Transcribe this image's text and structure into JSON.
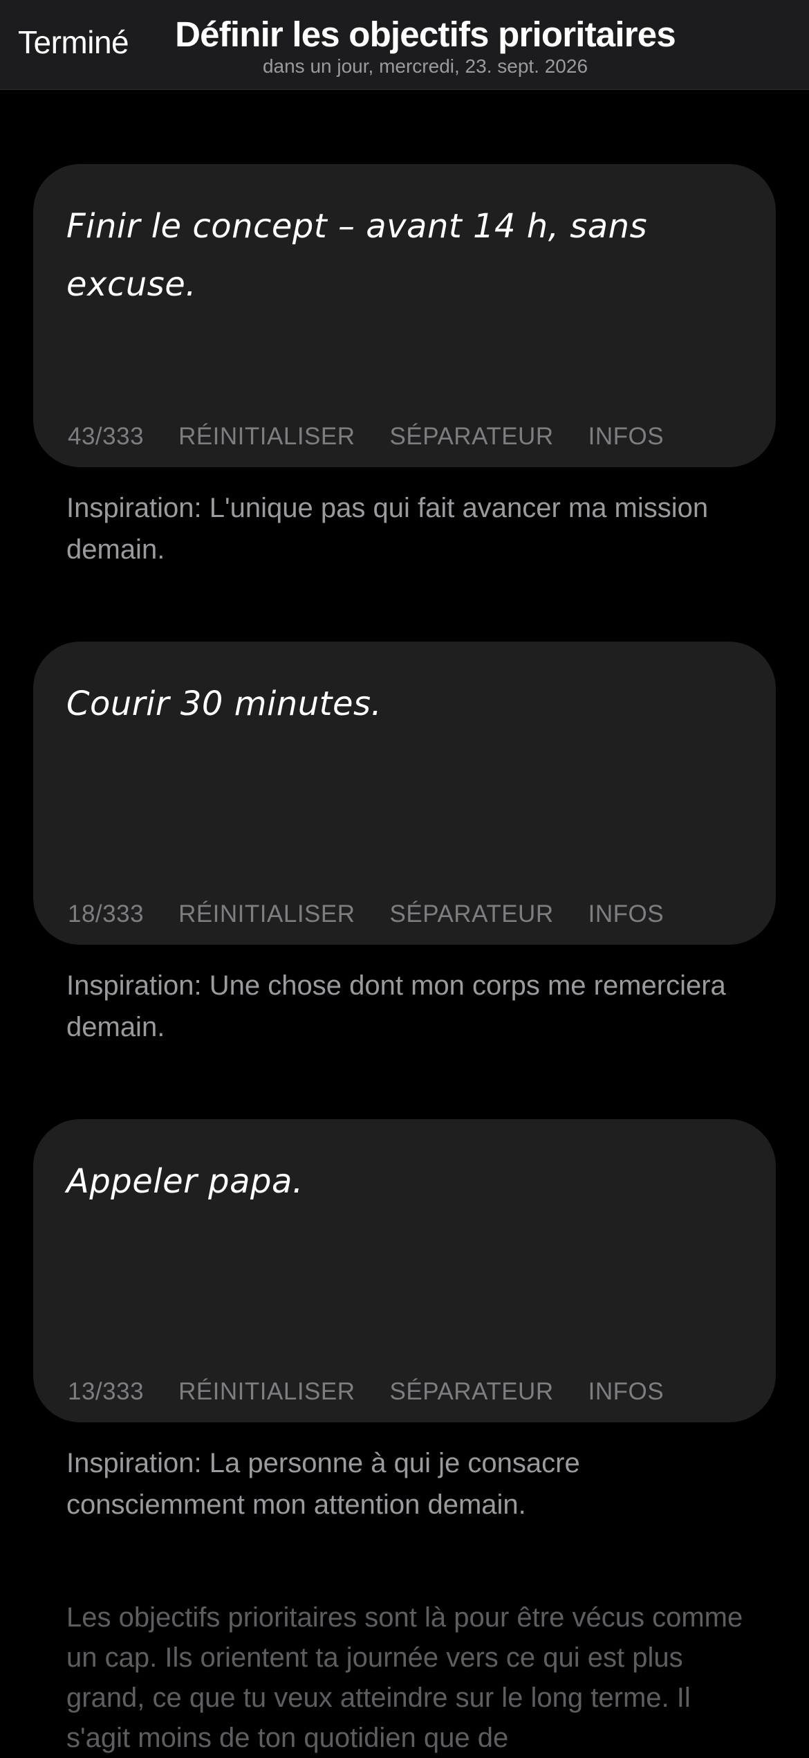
{
  "header": {
    "done_label": "Terminé",
    "title": "Définir les objectifs prioritaires",
    "subtitle": "dans un jour, mercredi, 23. sept. 2026"
  },
  "goals": [
    {
      "text": "Finir le concept – avant 14 h, sans excuse.",
      "count": "43/333",
      "reset_label": "RÉINITIALISER",
      "separator_label": "SÉPARATEUR",
      "info_label": "INFOS",
      "inspiration": "Inspiration: L'unique pas qui fait avancer ma mission demain."
    },
    {
      "text": "Courir 30 minutes.",
      "count": "18/333",
      "reset_label": "RÉINITIALISER",
      "separator_label": "SÉPARATEUR",
      "info_label": "INFOS",
      "inspiration": "Inspiration: Une chose dont mon corps me remerciera demain."
    },
    {
      "text": "Appeler papa.",
      "count": "13/333",
      "reset_label": "RÉINITIALISER",
      "separator_label": "SÉPARATEUR",
      "info_label": "INFOS",
      "inspiration": "Inspiration: La personne à qui je consacre consciemment mon attention demain."
    }
  ],
  "footer": {
    "text": "Les objectifs prioritaires sont là pour être vécus comme un cap. Ils orientent ta journée vers ce qui est plus grand, ce que tu veux atteindre sur le long terme. Il s'agit moins de ton quotidien que de"
  }
}
